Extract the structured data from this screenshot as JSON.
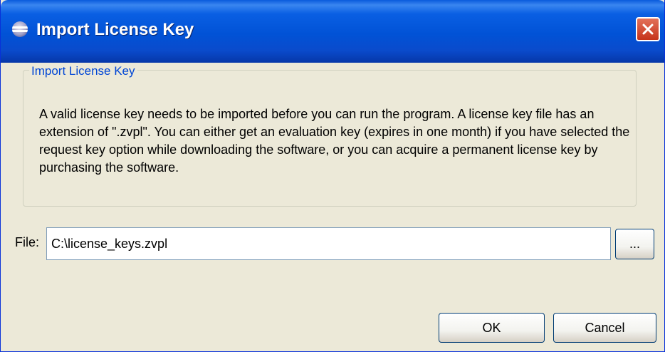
{
  "window": {
    "title": "Import License Key"
  },
  "group": {
    "label": "Import License Key",
    "description": "A valid license key needs to be imported before you can run the program. A license key file has an extension of \".zvpl\". You can either get an evaluation key (expires in one month) if you have selected the request key option while downloading the software, or you can acquire a permanent license key by purchasing the software."
  },
  "file": {
    "label": "File:",
    "value": "C:\\license_keys.zvpl",
    "browse_label": "..."
  },
  "buttons": {
    "ok": "OK",
    "cancel": "Cancel"
  },
  "icons": {
    "title": "eclipse-icon",
    "close": "close-icon"
  },
  "colors": {
    "titlebar": "#0152d6",
    "close_button": "#c6331b",
    "group_label": "#0046d5",
    "dialog_background": "#ece9d8"
  }
}
